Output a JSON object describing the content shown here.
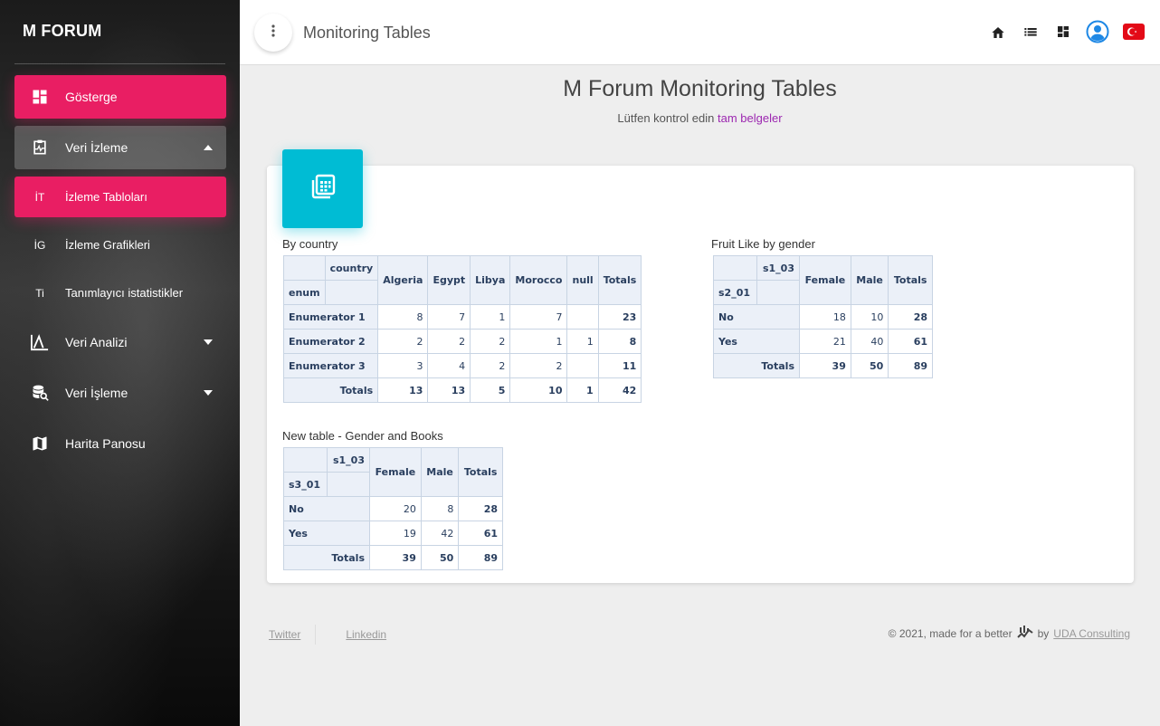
{
  "sidebar": {
    "brand": "M FORUM",
    "items": [
      {
        "label": "Gösterge",
        "icon": "dashboard-icon"
      },
      {
        "label": "Veri İzleme",
        "icon": "monitor-heart-icon"
      },
      {
        "abbr": "İT",
        "label": "İzleme Tabloları"
      },
      {
        "abbr": "İG",
        "label": "İzleme Grafikleri"
      },
      {
        "abbr": "Ti",
        "label": "Tanımlayıcı istatistikler"
      },
      {
        "label": "Veri Analizi",
        "icon": "analytics-icon"
      },
      {
        "label": "Veri İşleme",
        "icon": "database-search-icon"
      },
      {
        "label": "Harita Panosu",
        "icon": "map-icon"
      }
    ]
  },
  "topbar": {
    "title": "Monitoring Tables",
    "icons": [
      "home-icon",
      "list-icon",
      "dashboard-icon",
      "account-icon",
      "turkey-flag-icon"
    ]
  },
  "header": {
    "title": "M Forum Monitoring Tables",
    "subtitle_prefix": "Lütfen kontrol edin",
    "subtitle_link": "tam belgeler"
  },
  "tables": {
    "t1": {
      "title": "By country",
      "col_var": "country",
      "row_var": "enum",
      "columns": [
        "Algeria",
        "Egypt",
        "Libya",
        "Morocco",
        "null",
        "Totals"
      ],
      "rows": [
        {
          "label": "Enumerator 1",
          "values": [
            "8",
            "7",
            "1",
            "7",
            "",
            "23"
          ]
        },
        {
          "label": "Enumerator 2",
          "values": [
            "2",
            "2",
            "2",
            "1",
            "1",
            "8"
          ]
        },
        {
          "label": "Enumerator 3",
          "values": [
            "3",
            "4",
            "2",
            "2",
            "",
            "11"
          ]
        }
      ],
      "totals_label": "Totals",
      "totals": [
        "13",
        "13",
        "5",
        "10",
        "1",
        "42"
      ]
    },
    "t2": {
      "title": "Fruit Like by gender",
      "col_var": "s1_03",
      "row_var": "s2_01",
      "columns": [
        "Female",
        "Male",
        "Totals"
      ],
      "rows": [
        {
          "label": "No",
          "values": [
            "18",
            "10",
            "28"
          ]
        },
        {
          "label": "Yes",
          "values": [
            "21",
            "40",
            "61"
          ]
        }
      ],
      "totals_label": "Totals",
      "totals": [
        "39",
        "50",
        "89"
      ]
    },
    "t3": {
      "title": "New table - Gender and Books",
      "col_var": "s1_03",
      "row_var": "s3_01",
      "columns": [
        "Female",
        "Male",
        "Totals"
      ],
      "rows": [
        {
          "label": "No",
          "values": [
            "20",
            "8",
            "28"
          ]
        },
        {
          "label": "Yes",
          "values": [
            "19",
            "42",
            "61"
          ]
        }
      ],
      "totals_label": "Totals",
      "totals": [
        "39",
        "50",
        "89"
      ]
    }
  },
  "footer": {
    "links": [
      "Twitter",
      "Linkedin"
    ],
    "copyright": "© 2021, made for a better",
    "by": "by",
    "company": "UDA Consulting"
  },
  "colors": {
    "accent": "#e91e63",
    "card_icon": "#00bcd4",
    "link": "#9c27b0"
  }
}
